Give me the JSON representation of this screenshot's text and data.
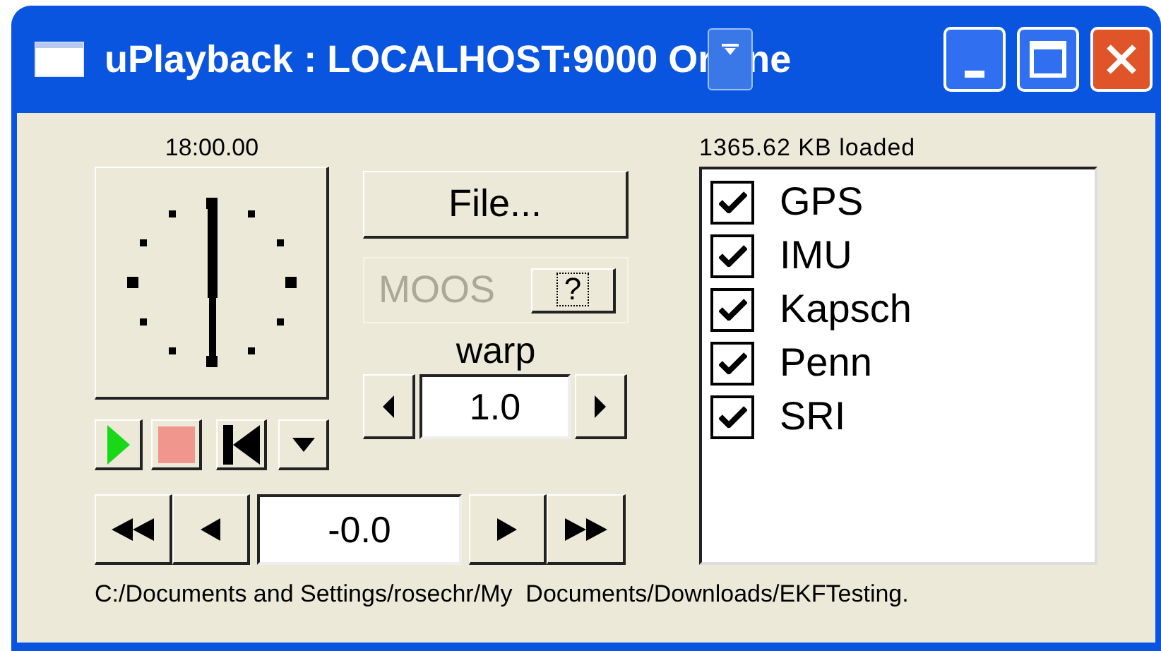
{
  "window": {
    "title": "uPlayback : LOCALHOST:9000 Or",
    "title_tail": "ne"
  },
  "clock": {
    "time": "18:00.00"
  },
  "buttons": {
    "file": "File...",
    "moos": "MOOS",
    "moos_help": "?",
    "moos_disabled": true
  },
  "warp": {
    "label": "warp",
    "value": "1.0"
  },
  "offset": {
    "value": "-0.0"
  },
  "loaded": "1365.62 KB loaded",
  "sources": [
    {
      "label": "GPS",
      "checked": true
    },
    {
      "label": "IMU",
      "checked": true
    },
    {
      "label": "Kapsch",
      "checked": true
    },
    {
      "label": "Penn",
      "checked": true
    },
    {
      "label": "SRI",
      "checked": true
    }
  ],
  "status_bar": "C:/Documents and Settings/rosechr/My  Documents/Downloads/EKFTesting."
}
